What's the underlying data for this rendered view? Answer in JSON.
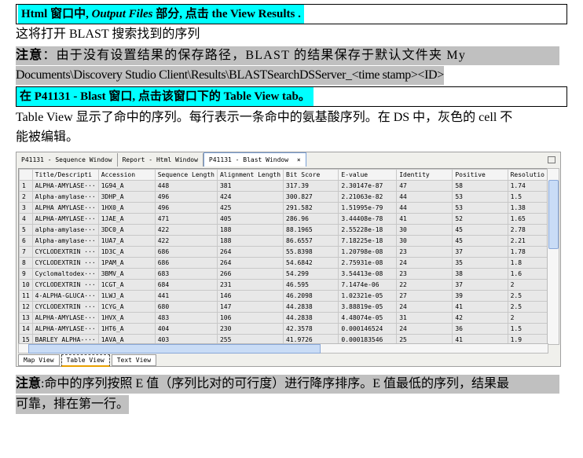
{
  "step1": {
    "prefix": "Html  窗口中, ",
    "italic": "Output Files",
    "suffix": "  部分, 点击  the View Results ."
  },
  "line1": "这将打开 BLAST 搜索找到的序列",
  "note1": {
    "label": "注意",
    "text1": "：由于没有设置结果的保存路径，BLAST  的结果保存于默认文件夹  My",
    "text2": "Documents\\Discovery Studio Client\\Results\\BLASTSearchDSServer_<time stamp><ID>"
  },
  "step2": "在 P41131 - Blast  窗口, 点击该窗口下的 Table View tab。",
  "line2a": "Table View 显示了命中的序列。每行表示一条命中的氨基酸序列。在 DS 中，灰色的 cell 不",
  "line2b": "能被编辑。",
  "window": {
    "tabs": [
      "P41131 - Sequence Window",
      "Report - Html Window",
      "P41131 - Blast Window"
    ],
    "close": "×",
    "columns": [
      "",
      "Title/Descripti",
      "Accession",
      "Sequence Length",
      "Alignment Length",
      "Bit Score",
      "E-value",
      "Identity",
      "Positive",
      "Resolutio"
    ],
    "rows": [
      [
        "1",
        "ALPHA-AMYLASE···",
        "1G94_A",
        "448",
        "381",
        "317.39",
        "2.30147e-87",
        "47",
        "58",
        "1.74"
      ],
      [
        "2",
        "Alpha-amylase···",
        "3DHP_A",
        "496",
        "424",
        "300.827",
        "2.21063e-82",
        "44",
        "53",
        "1.5"
      ],
      [
        "3",
        "ALPHA AMYLASE···",
        "1HX0_A",
        "496",
        "425",
        "291.582",
        "1.51995e-79",
        "44",
        "53",
        "1.38"
      ],
      [
        "4",
        "ALPHA-AMYLASE···",
        "1JAE_A",
        "471",
        "405",
        "286.96",
        "3.44408e-78",
        "41",
        "52",
        "1.65"
      ],
      [
        "5",
        "alpha-amylase···",
        "3DC0_A",
        "422",
        "188",
        "88.1965",
        "2.55228e-18",
        "30",
        "45",
        "2.78"
      ],
      [
        "6",
        "Alpha-amylase···",
        "1UA7_A",
        "422",
        "188",
        "86.6557",
        "7.18225e-18",
        "30",
        "45",
        "2.21"
      ],
      [
        "7",
        "CYCLODEXTRIN ···",
        "1D3C_A",
        "686",
        "264",
        "55.8398",
        "1.20798e-08",
        "23",
        "37",
        "1.78"
      ],
      [
        "8",
        "CYCLODEXTRIN ···",
        "1PAM_A",
        "686",
        "264",
        "54.6842",
        "2.75931e-08",
        "24",
        "35",
        "1.8"
      ],
      [
        "9",
        "Cyclomaltodex···",
        "3BMV_A",
        "683",
        "266",
        "54.299",
        "3.54413e-08",
        "23",
        "38",
        "1.6"
      ],
      [
        "10",
        "CYCLODEXTRIN ···",
        "1CGT_A",
        "684",
        "231",
        "46.595",
        "7.1474e-06",
        "22",
        "37",
        "2"
      ],
      [
        "11",
        "4-ALPHA-GLUCA···",
        "1LWJ_A",
        "441",
        "146",
        "46.2098",
        "1.02321e-05",
        "27",
        "39",
        "2.5"
      ],
      [
        "12",
        "CYCLODEXTRIN ···",
        "1CYG_A",
        "680",
        "147",
        "44.2838",
        "3.88819e-05",
        "24",
        "41",
        "2.5"
      ],
      [
        "13",
        "ALPHA-AMYLASE···",
        "1HVX_A",
        "483",
        "106",
        "44.2838",
        "4.48074e-05",
        "31",
        "42",
        "2"
      ],
      [
        "14",
        "ALPHA-AMYLASE···",
        "1HT6_A",
        "404",
        "230",
        "42.3578",
        "0.000146524",
        "24",
        "36",
        "1.5"
      ],
      [
        "15",
        "BARLEY ALPHA-···",
        "1AVA_A",
        "403",
        "255",
        "41.9726",
        "0.000183546",
        "25",
        "41",
        "1.9"
      ]
    ],
    "bottom_tabs": [
      "Map View",
      "Table View",
      "Text View"
    ]
  },
  "note2": {
    "label": "注意",
    "text1": ":命中的序列按照 E 值（序列比对的可行度）进行降序排序。E 值最低的序列，结果最",
    "text2": "可靠，排在第一行。"
  }
}
